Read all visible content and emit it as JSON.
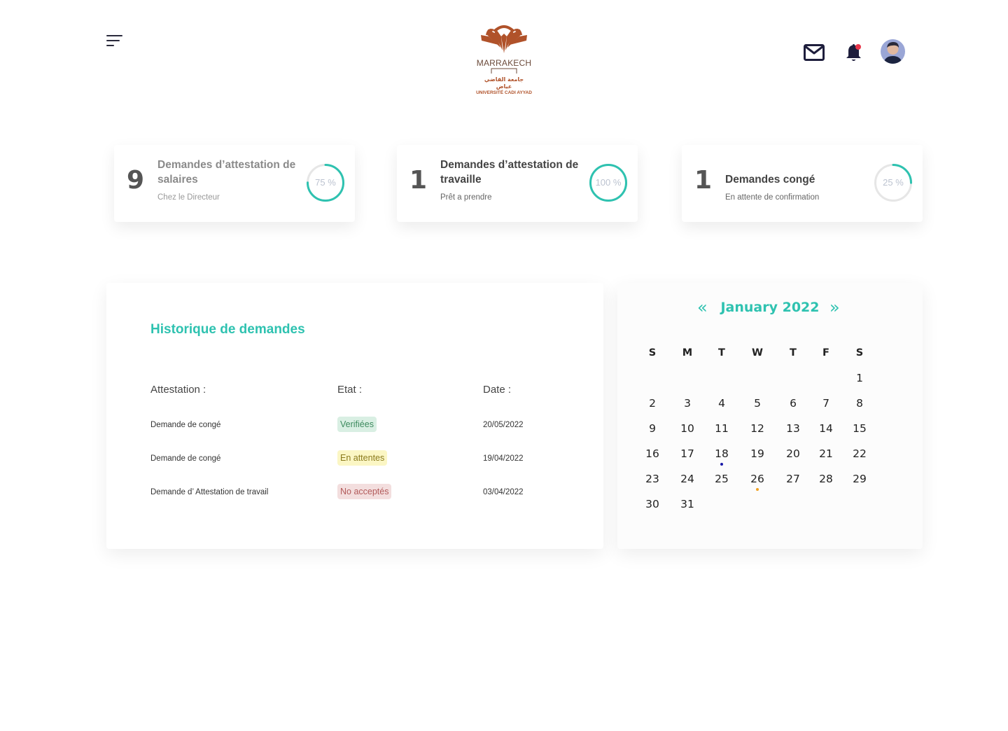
{
  "header": {
    "logo": {
      "word": "MARRAKECH",
      "arabic": "جامعة القاضي عياض",
      "french": "UNIVERSITÉ CADI AYYAD"
    },
    "notification_color": "#e8354a"
  },
  "stats": [
    {
      "count": "9",
      "title": "Demandes d’attestation de salaires",
      "subtitle": "Chez le Directeur",
      "percent": "75 %",
      "progress": 0.75
    },
    {
      "count": "1",
      "title": "Demandes d’attestation de travaille",
      "subtitle": "Prêt a prendre",
      "percent": "100 %",
      "progress": 1.0
    },
    {
      "count": "1",
      "title": "Demandes congé",
      "subtitle": "En attente de confirmation",
      "percent": "25 %",
      "progress": 0.25
    }
  ],
  "history": {
    "title": "Historique de demandes",
    "columns": {
      "attestation": "Attestation :",
      "etat": "Etat :",
      "date": "Date :"
    },
    "rows": [
      {
        "attestation": "Demande de congé",
        "etat": "Verifiées",
        "status": "verified",
        "date": "20/05/2022"
      },
      {
        "attestation": "Demande de congé",
        "etat": "En attentes",
        "status": "pending",
        "date": "19/04/2022"
      },
      {
        "attestation": "Demande d’ Attestation de travail",
        "etat": "No acceptés",
        "status": "rejected",
        "date": "03/04/2022"
      }
    ]
  },
  "calendar": {
    "month": "January 2022",
    "prev": "«",
    "next": "»",
    "weekdays": [
      "S",
      "M",
      "T",
      "W",
      "T",
      "F",
      "S"
    ],
    "first_weekday_index": 6,
    "days_in_month": 31,
    "marked_days": [
      {
        "day": 18,
        "color": "#1a1aa8"
      },
      {
        "day": 26,
        "color": "#f0a020"
      }
    ]
  },
  "colors": {
    "accent": "#2ec2b0",
    "ring_track": "#e6e6e6",
    "badge_verified_bg": "#d9efe3",
    "badge_verified_fg": "#3d8a5e",
    "badge_pending_bg": "#fbf6c4",
    "badge_pending_fg": "#8a7a1c",
    "badge_rejected_bg": "#f3dede",
    "badge_rejected_fg": "#b25a5a"
  }
}
